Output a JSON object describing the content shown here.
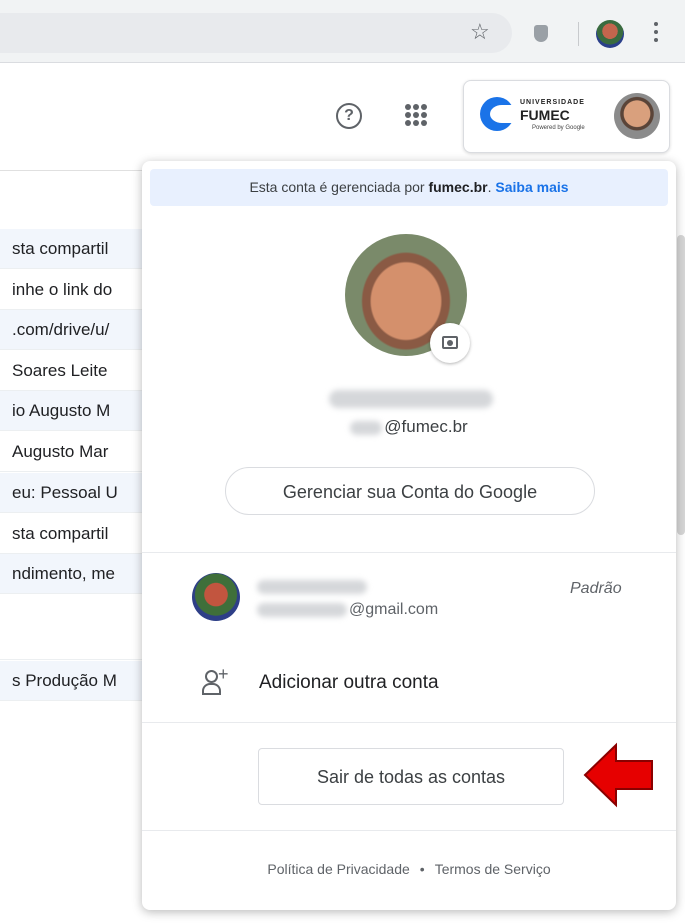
{
  "browser": {
    "icons": [
      "star-icon",
      "shield-icon",
      "profile-avatar",
      "menu-icon"
    ]
  },
  "header": {
    "help_symbol": "?",
    "org_logo": {
      "top": "UNIVERSIDADE",
      "name": "FUMEC",
      "powered": "Powered by Google"
    }
  },
  "mail_list": {
    "rows": [
      "sta compartil",
      "inhe o link do",
      ".com/drive/u/",
      "Soares Leite",
      "io Augusto M",
      "Augusto Mar",
      "eu: Pessoal U",
      "sta compartil",
      "ndimento, me",
      "",
      "s Produção M"
    ]
  },
  "popup": {
    "banner_text": "Esta conta é gerenciada por ",
    "banner_domain": "fumec.br",
    "banner_period": ".",
    "banner_link": "Saiba mais",
    "email_suffix": "@fumec.br",
    "manage_label": "Gerenciar sua Conta do Google",
    "other_account": {
      "email_suffix": "@gmail.com",
      "badge": "Padrão"
    },
    "add_account_label": "Adicionar outra conta",
    "signout_label": "Sair de todas as contas",
    "footer": {
      "privacy": "Política de Privacidade",
      "separator": "•",
      "terms": "Termos de Serviço"
    }
  },
  "colors": {
    "accent": "#1a73e8",
    "banner_bg": "#e8f0fe",
    "arrow": "#e60000"
  }
}
